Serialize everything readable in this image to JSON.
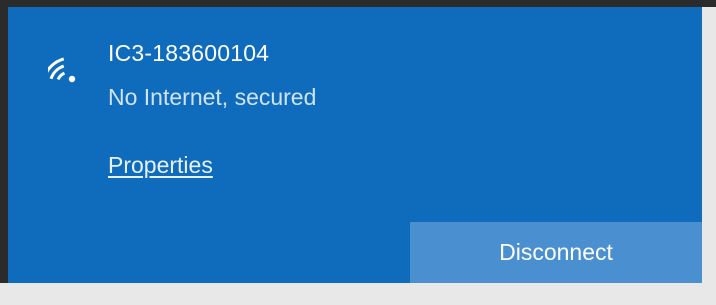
{
  "network": {
    "ssid": "IC3-183600104",
    "status": "No Internet, secured",
    "properties_link": "Properties",
    "disconnect_label": "Disconnect",
    "icon": "wifi-icon"
  },
  "colors": {
    "panel_bg": "#0f6cbd",
    "button_bg": "#4a90d0",
    "text_primary": "#ffffff",
    "text_secondary": "#cfe3f5"
  }
}
